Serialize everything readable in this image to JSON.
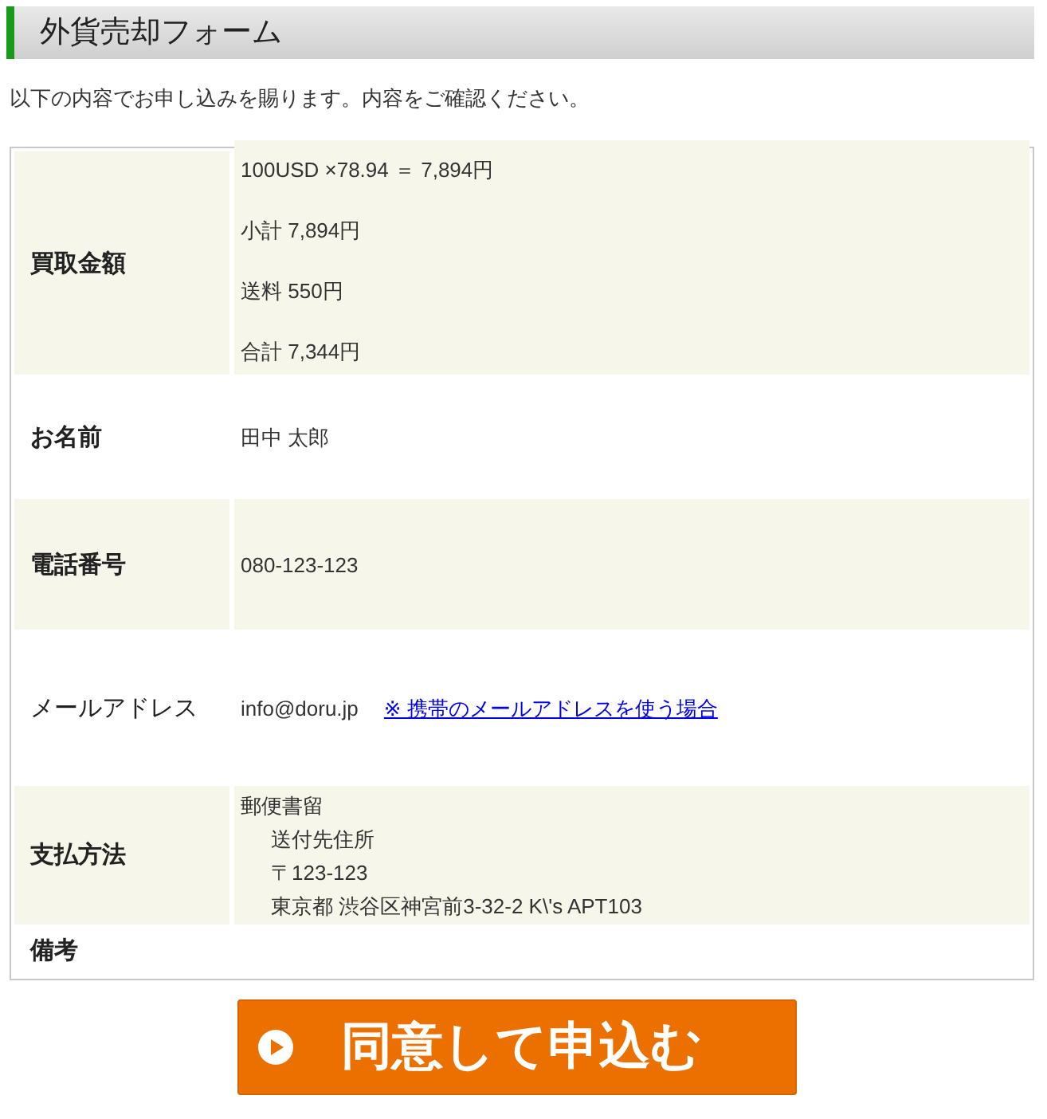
{
  "heading": "外貨売却フォーム",
  "intro": "以下の内容でお申し込みを賜ります。内容をご確認ください。",
  "rows": [
    {
      "label": "買取金額",
      "bold": true,
      "lines": [
        "100USD ×78.94 ＝ 7,894円",
        "小計  7,894円",
        "送料  550円",
        "合計  7,344円"
      ]
    },
    {
      "label": "お名前",
      "bold": true,
      "lines": [
        "田中 太郎"
      ]
    },
    {
      "label": "電話番号",
      "bold": true,
      "lines": [
        "080-123-123"
      ]
    },
    {
      "label": "メールアドレス",
      "bold": false,
      "lines": [
        "info@doru.jp"
      ],
      "link": "※ 携帯のメールアドレスを使う場合"
    },
    {
      "label": "支払方法",
      "bold": true,
      "lines": [
        "郵便書留"
      ],
      "children": [
        "送付先住所",
        "〒123-123",
        "東京都 渋谷区神宮前3-32-2 K\\'s APT103"
      ]
    },
    {
      "label": "備考",
      "bold": true,
      "lines": []
    }
  ],
  "submit_button": "同意して申込む"
}
